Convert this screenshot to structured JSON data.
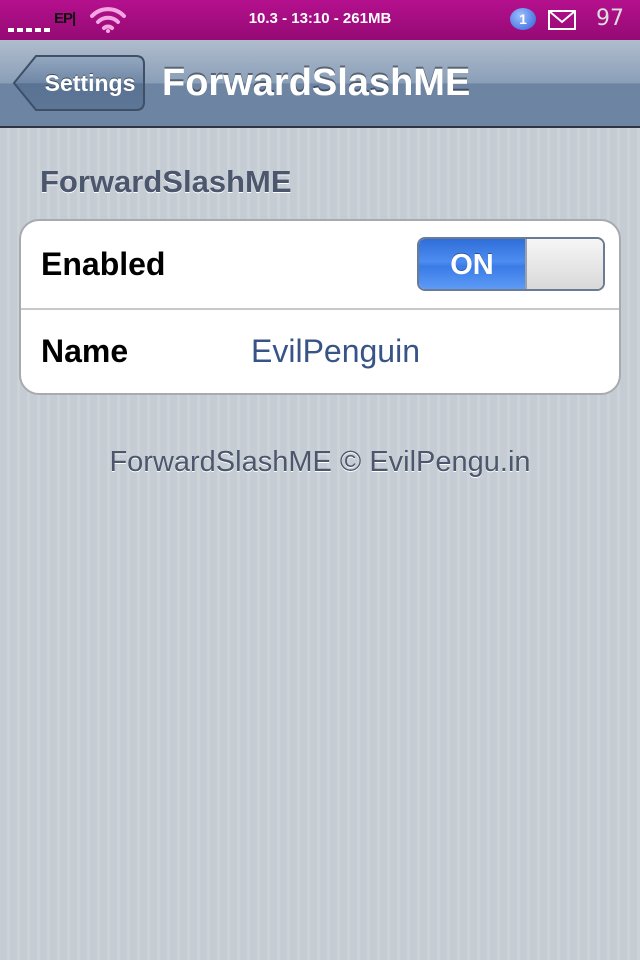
{
  "status_bar": {
    "carrier": "EP|",
    "center_text": "10.3 - 13:10 - 261MB",
    "notification_count": "1",
    "battery": "97",
    "icons": [
      "signal-icon",
      "wifi-icon",
      "chat-badge-icon",
      "mail-icon"
    ]
  },
  "nav": {
    "back_label": "Settings",
    "title": "ForwardSlashME"
  },
  "section": {
    "header": "ForwardSlashME"
  },
  "cells": {
    "enabled": {
      "label": "Enabled",
      "toggle_label": "ON",
      "toggle_state": true
    },
    "name": {
      "label": "Name",
      "value": "EvilPenguin"
    }
  },
  "footer": {
    "text": "ForwardSlashME © EvilPengu.in"
  },
  "colors": {
    "status_bar": "#a80d85",
    "nav_bar": "#6d84a2",
    "toggle_on": "#3a7be6",
    "value_text": "#385487",
    "section_text": "#4c566c",
    "background": "#c5ccd4"
  }
}
